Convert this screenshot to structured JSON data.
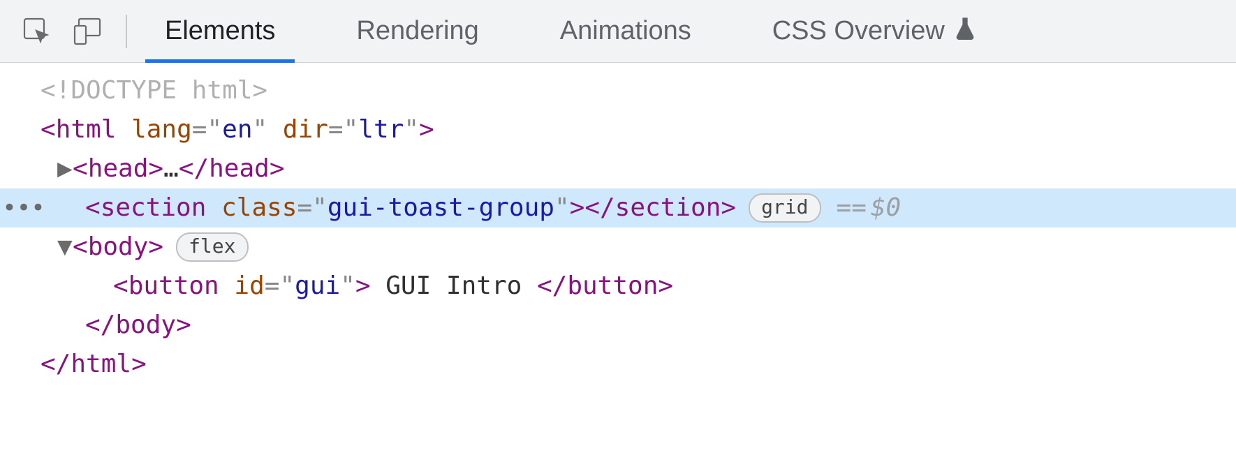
{
  "toolbar": {
    "tabs": {
      "elements": "Elements",
      "rendering": "Rendering",
      "animations": "Animations",
      "cssoverview": "CSS Overview"
    }
  },
  "tree": {
    "doctype": "<!DOCTYPE html>",
    "html_tag": "html",
    "html_attr_lang_name": "lang",
    "html_attr_lang_val": "en",
    "html_attr_dir_name": "dir",
    "html_attr_dir_val": "ltr",
    "head_tag": "head",
    "head_ellipsis": "…",
    "section_tag": "section",
    "section_attr_class_name": "class",
    "section_attr_class_val": "gui-toast-group",
    "section_badge": "grid",
    "section_console_ref": "$0",
    "section_console_eq": "==",
    "body_tag": "body",
    "body_badge": "flex",
    "button_tag": "button",
    "button_attr_id_name": "id",
    "button_attr_id_val": "gui",
    "button_text": " GUI Intro "
  },
  "glyphs": {
    "arrow_right": "▶",
    "arrow_down": "▼",
    "more": "•••"
  }
}
